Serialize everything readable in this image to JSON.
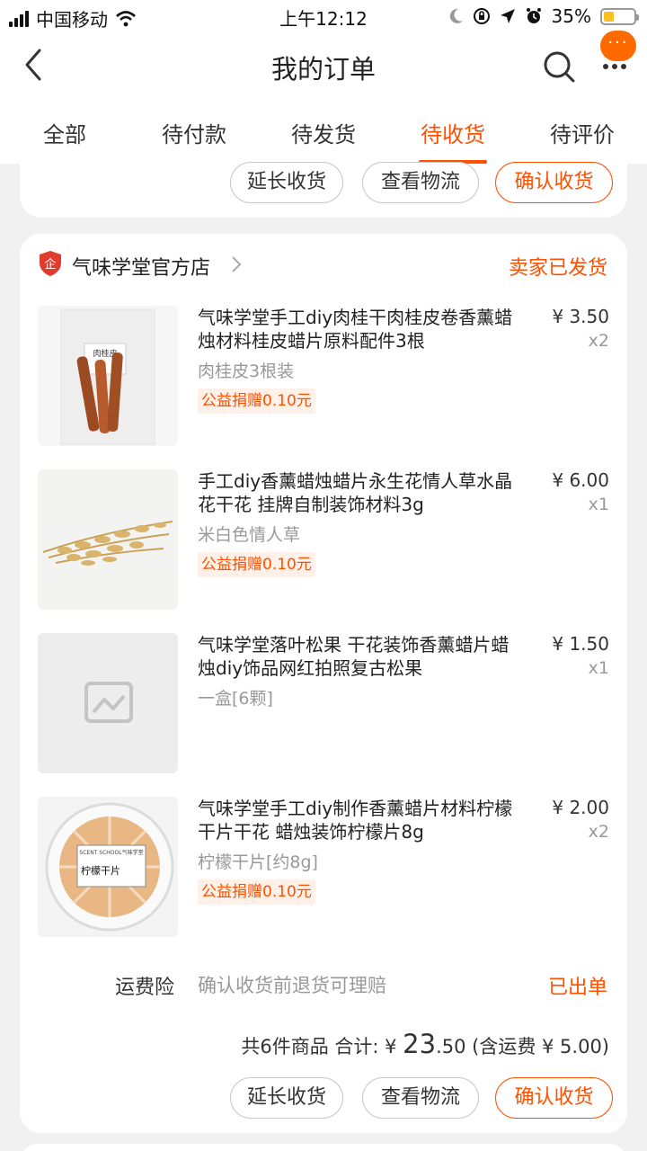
{
  "status_bar": {
    "carrier": "中国移动",
    "time": "上午12:12",
    "battery_pct": "35%",
    "battery_fraction": 0.35
  },
  "nav": {
    "title": "我的订单",
    "more_badge": "···"
  },
  "tabs": [
    {
      "label": "全部"
    },
    {
      "label": "待付款"
    },
    {
      "label": "待发货"
    },
    {
      "label": "待收货",
      "active": true
    },
    {
      "label": "待评价"
    }
  ],
  "prev_order": {
    "buttons": {
      "extend": "延长收货",
      "logistics": "查看物流",
      "confirm": "确认收货"
    }
  },
  "order": {
    "shop_name": "气味学堂官方店",
    "status": "卖家已发货",
    "items": [
      {
        "title": "气味学堂手工diy肉桂干肉桂皮卷香薰蜡烛材料桂皮蜡片原料配件3根",
        "sku": "肉桂皮3根装",
        "tag": "公益捐赠0.10元",
        "price": "¥ 3.50",
        "qty": "x2",
        "thumb_label": "肉桂皮"
      },
      {
        "title": "手工diy香薰蜡烛蜡片永生花情人草水晶花干花 挂牌自制装饰材料3g",
        "sku": "米白色情人草",
        "tag": "公益捐赠0.10元",
        "price": "¥ 6.00",
        "qty": "x1"
      },
      {
        "title": "气味学堂落叶松果 干花装饰香薰蜡片蜡烛diy饰品网红拍照复古松果",
        "sku": "一盒[6颗]",
        "tag": "",
        "price": "¥ 1.50",
        "qty": "x1"
      },
      {
        "title": "气味学堂手工diy制作香薰蜡片材料柠檬干片干花 蜡烛装饰柠檬片8g",
        "sku": "柠檬干片[约8g]",
        "tag": "公益捐赠0.10元",
        "price": "¥ 2.00",
        "qty": "x2",
        "thumb_label": "柠檬干片",
        "thumb_brand": "SCENT SCHOOL气味学堂"
      }
    ],
    "insurance": {
      "label": "运费险",
      "desc": "确认收货前退货可理赔",
      "status": "已出单"
    },
    "summary": {
      "count_text": "共6件商品 合计: ¥ ",
      "total_int": "23",
      "total_dec": ".50",
      "shipping_text": " (含运费 ¥ 5.00)"
    },
    "buttons": {
      "extend": "延长收货",
      "logistics": "查看物流",
      "confirm": "确认收货"
    }
  }
}
